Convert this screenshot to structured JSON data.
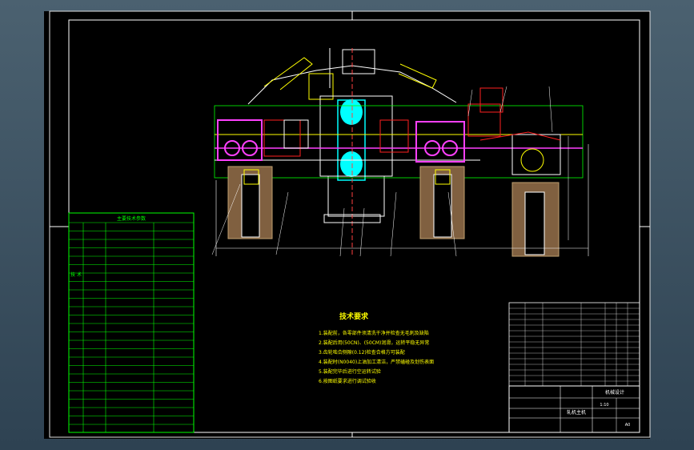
{
  "drawing": {
    "tech_title": "技术要求",
    "tech_notes": [
      "1.装配前，各零部件须清洗干净并检查无毛刺及缺陷",
      "2.装配后用(50CN)、(50CM)润滑，运转平稳无异常",
      "3.齿轮啮合侧隙(0.12)检查合格方可装配",
      "4.装配时(N0040)上油加工清洁，严禁磕碰及划伤表面",
      "5.装配完毕后进行空运转试验",
      "6.按图纸要求进行调试验收"
    ],
    "param_table_title": "主要技术参数",
    "param_side_label": "技 术",
    "title_block": {
      "drawing_name": "轧机主机",
      "company": "机械设计",
      "scale": "1:10",
      "sheet": "A0"
    },
    "colors": {
      "background": "#000000",
      "frame": "#ffffff",
      "table": "#00ff00",
      "note_text": "#ffff00",
      "red": "#ff2020",
      "magenta": "#ff40ff",
      "yellow": "#ffff00",
      "cyan": "#00ffff",
      "green": "#00ff00",
      "blue": "#4060ff"
    }
  }
}
